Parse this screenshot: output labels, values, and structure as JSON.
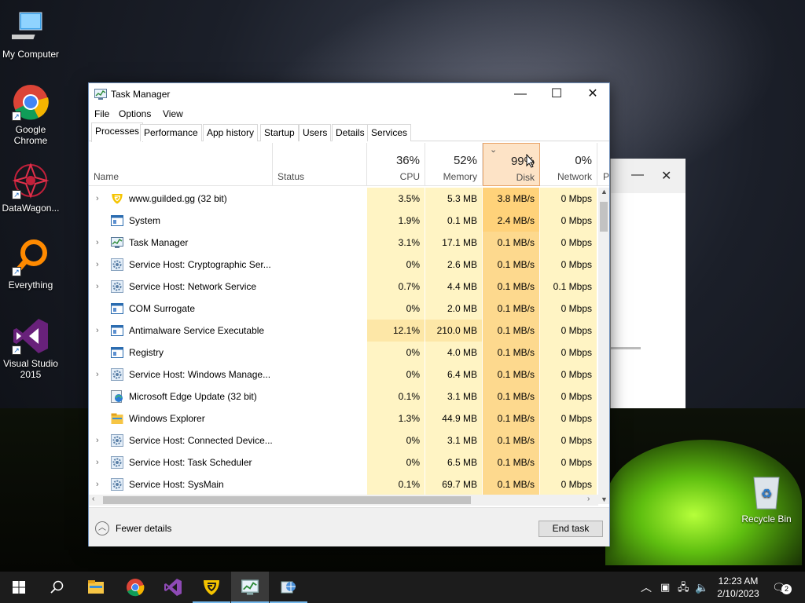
{
  "desktop": {
    "icons": [
      {
        "label": "My Computer",
        "icon": "computer-icon"
      },
      {
        "label": "Google Chrome",
        "icon": "chrome-icon"
      },
      {
        "label": "DataWagon...",
        "icon": "datawagon-icon"
      },
      {
        "label": "Everything",
        "icon": "everything-search-icon"
      },
      {
        "label": "Visual Studio 2015",
        "icon": "visual-studio-icon"
      },
      {
        "label": "Recycle Bin",
        "icon": "recycle-bin-icon"
      }
    ]
  },
  "window": {
    "title": "Task Manager",
    "menu": [
      "File",
      "Options",
      "View"
    ],
    "tabs": [
      "Processes",
      "Performance",
      "App history",
      "Startup",
      "Users",
      "Details",
      "Services"
    ],
    "active_tab": "Processes",
    "columns": {
      "name": "Name",
      "status": "Status",
      "cpu": {
        "pct": "36%",
        "label": "CPU"
      },
      "memory": {
        "pct": "52%",
        "label": "Memory"
      },
      "disk": {
        "pct": "99%",
        "label": "Disk"
      },
      "network": {
        "pct": "0%",
        "label": "Network"
      },
      "power": "P"
    },
    "processes": [
      {
        "name": "www.guilded.gg (32 bit)",
        "expandable": true,
        "icon": "guilded-icon",
        "cpu": "3.5%",
        "memory": "5.3 MB",
        "disk": "3.8 MB/s",
        "network": "0 Mbps"
      },
      {
        "name": "System",
        "expandable": false,
        "icon": "system-icon",
        "cpu": "1.9%",
        "memory": "0.1 MB",
        "disk": "2.4 MB/s",
        "network": "0 Mbps"
      },
      {
        "name": "Task Manager",
        "expandable": true,
        "icon": "task-manager-icon",
        "cpu": "3.1%",
        "memory": "17.1 MB",
        "disk": "0.1 MB/s",
        "network": "0 Mbps"
      },
      {
        "name": "Service Host: Cryptographic Ser...",
        "expandable": true,
        "icon": "gear-icon",
        "cpu": "0%",
        "memory": "2.6 MB",
        "disk": "0.1 MB/s",
        "network": "0 Mbps"
      },
      {
        "name": "Service Host: Network Service",
        "expandable": true,
        "icon": "gear-icon",
        "cpu": "0.7%",
        "memory": "4.4 MB",
        "disk": "0.1 MB/s",
        "network": "0.1 Mbps"
      },
      {
        "name": "COM Surrogate",
        "expandable": false,
        "icon": "system-icon",
        "cpu": "0%",
        "memory": "2.0 MB",
        "disk": "0.1 MB/s",
        "network": "0 Mbps"
      },
      {
        "name": "Antimalware Service Executable",
        "expandable": true,
        "icon": "system-icon",
        "cpu": "12.1%",
        "memory": "210.0 MB",
        "disk": "0.1 MB/s",
        "network": "0 Mbps"
      },
      {
        "name": "Registry",
        "expandable": false,
        "icon": "system-icon",
        "cpu": "0%",
        "memory": "4.0 MB",
        "disk": "0.1 MB/s",
        "network": "0 Mbps"
      },
      {
        "name": "Service Host: Windows Manage...",
        "expandable": true,
        "icon": "gear-icon",
        "cpu": "0%",
        "memory": "6.4 MB",
        "disk": "0.1 MB/s",
        "network": "0 Mbps"
      },
      {
        "name": "Microsoft Edge Update (32 bit)",
        "expandable": false,
        "icon": "edge-update-icon",
        "cpu": "0.1%",
        "memory": "3.1 MB",
        "disk": "0.1 MB/s",
        "network": "0 Mbps"
      },
      {
        "name": "Windows Explorer",
        "expandable": false,
        "icon": "folder-icon",
        "cpu": "1.3%",
        "memory": "44.9 MB",
        "disk": "0.1 MB/s",
        "network": "0 Mbps"
      },
      {
        "name": "Service Host: Connected Device...",
        "expandable": true,
        "icon": "gear-icon",
        "cpu": "0%",
        "memory": "3.1 MB",
        "disk": "0.1 MB/s",
        "network": "0 Mbps"
      },
      {
        "name": "Service Host: Task Scheduler",
        "expandable": true,
        "icon": "gear-icon",
        "cpu": "0%",
        "memory": "6.5 MB",
        "disk": "0.1 MB/s",
        "network": "0 Mbps"
      },
      {
        "name": "Service Host: SysMain",
        "expandable": true,
        "icon": "gear-icon",
        "cpu": "0.1%",
        "memory": "69.7 MB",
        "disk": "0.1 MB/s",
        "network": "0 Mbps"
      }
    ],
    "footer": {
      "fewer_details": "Fewer details",
      "end_task": "End task"
    }
  },
  "taskbar": {
    "items": [
      "windows-start-icon",
      "search-icon",
      "file-explorer-icon",
      "chrome-icon",
      "visual-studio-icon",
      "guilded-icon",
      "task-manager-icon",
      "network-globe-icon"
    ],
    "clock_time": "12:23 AM",
    "clock_date": "2/10/2023",
    "notification_count": "2"
  },
  "colors": {
    "cpu_bg": "#fff4c4",
    "disk_high": "#ffd27a",
    "disk_bg": "#fdd98e",
    "accent": "#0078d7"
  }
}
